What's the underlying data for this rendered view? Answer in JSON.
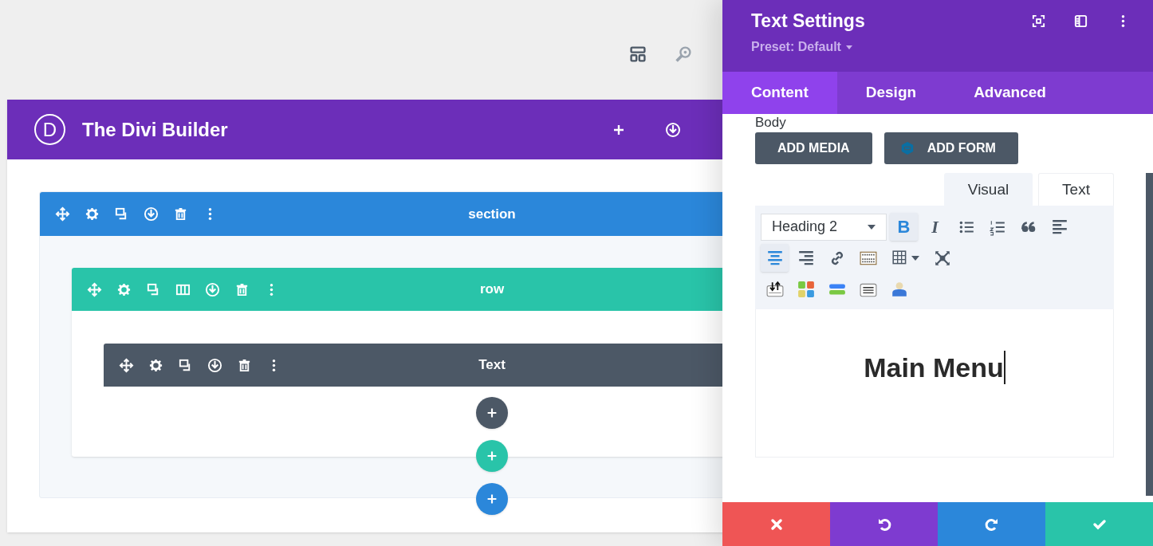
{
  "top_toolbar": [
    {
      "kind": "layout"
    },
    {
      "kind": "zoom"
    }
  ],
  "builder": {
    "logo": "D",
    "title": "The Divi Builder",
    "header_actions": [
      {
        "kind": "plus"
      },
      {
        "kind": "download"
      }
    ],
    "section": {
      "label": "section",
      "tools": [
        {
          "kind": "move"
        },
        {
          "kind": "settings"
        },
        {
          "kind": "duplicate"
        },
        {
          "kind": "download"
        },
        {
          "kind": "trash"
        },
        {
          "kind": "more"
        }
      ]
    },
    "row": {
      "label": "row",
      "tools": [
        {
          "kind": "move"
        },
        {
          "kind": "settings"
        },
        {
          "kind": "duplicate"
        },
        {
          "kind": "columns"
        },
        {
          "kind": "download"
        },
        {
          "kind": "trash"
        },
        {
          "kind": "more"
        }
      ]
    },
    "module": {
      "label": "Text",
      "tools": [
        {
          "kind": "move"
        },
        {
          "kind": "settings"
        },
        {
          "kind": "duplicate"
        },
        {
          "kind": "download"
        },
        {
          "kind": "trash"
        },
        {
          "kind": "more"
        }
      ]
    },
    "add_buttons": [
      {
        "color": "#4c5866"
      },
      {
        "color": "#29c4a9"
      },
      {
        "color": "#2b87da"
      }
    ]
  },
  "modal": {
    "title": "Text Settings",
    "preset": "Preset: Default",
    "tabs": [
      {
        "label": "Content",
        "selected": true
      },
      {
        "label": "Design",
        "selected": false
      },
      {
        "label": "Advanced",
        "selected": false
      }
    ],
    "field_label": "Body",
    "buttons": [
      {
        "label": "ADD MEDIA",
        "kind": "plain"
      },
      {
        "label": "ADD FORM",
        "kind": "form"
      }
    ],
    "editor_tabs": [
      {
        "label": "Visual",
        "selected": true
      },
      {
        "label": "Text",
        "selected": false
      }
    ],
    "format": "Heading 2",
    "toolbar_rows": [
      [
        {
          "kind": "bold",
          "label": "B",
          "active": true
        },
        {
          "kind": "italic",
          "label": "I",
          "active": false
        },
        {
          "kind": "bullets",
          "active": false
        },
        {
          "kind": "numbers",
          "active": false
        },
        {
          "kind": "quote",
          "active": false
        },
        {
          "kind": "align-left",
          "active": false
        }
      ],
      [
        {
          "kind": "align-center",
          "active": true
        },
        {
          "kind": "align-right",
          "active": false
        },
        {
          "kind": "link",
          "active": false
        },
        {
          "kind": "keyboard",
          "active": false
        },
        {
          "kind": "table",
          "active": false
        },
        {
          "kind": "fullscreen",
          "active": false
        }
      ],
      [
        {
          "kind": "sort",
          "active": false
        },
        {
          "kind": "grid",
          "active": false
        },
        {
          "kind": "bars",
          "active": false
        },
        {
          "kind": "lines",
          "active": false
        },
        {
          "kind": "user",
          "active": false
        }
      ]
    ],
    "content": "Main Menu",
    "footer": [
      {
        "kind": "cancel",
        "color": "#ef5555"
      },
      {
        "kind": "undo",
        "color": "#7e3bd0"
      },
      {
        "kind": "redo",
        "color": "#2b87da"
      },
      {
        "kind": "save",
        "color": "#29c4a9"
      }
    ]
  }
}
